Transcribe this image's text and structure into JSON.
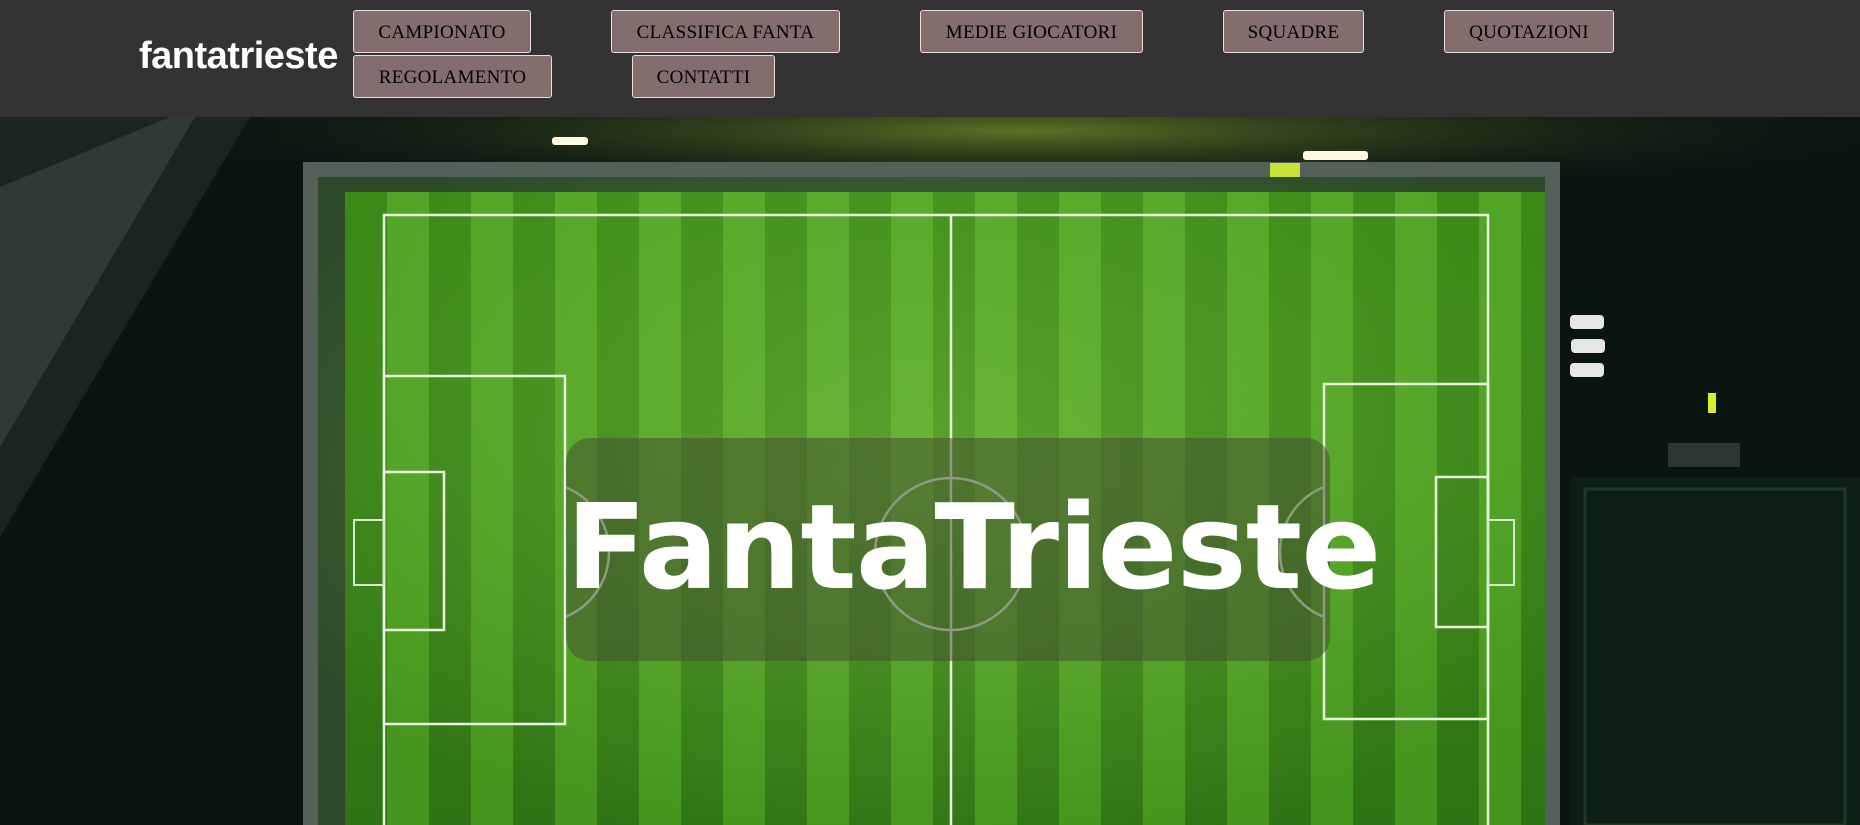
{
  "header": {
    "brand": "fantatrieste",
    "nav": [
      {
        "label": "CAMPIONATO"
      },
      {
        "label": "CLASSIFICA FANTA"
      },
      {
        "label": "MEDIE GIOCATORI"
      },
      {
        "label": "SQUADRE"
      },
      {
        "label": "QUOTAZIONI"
      },
      {
        "label": "REGOLAMENTO"
      },
      {
        "label": "CONTATTI"
      }
    ]
  },
  "hero": {
    "title": "FantaTrieste",
    "background_image": "aerial-night-football-pitch"
  },
  "colors": {
    "header_bg": "#333333",
    "nav_button_bg": "#836d6d",
    "nav_button_border": "#e6dede",
    "pitch_green": "#3f8f1c"
  }
}
